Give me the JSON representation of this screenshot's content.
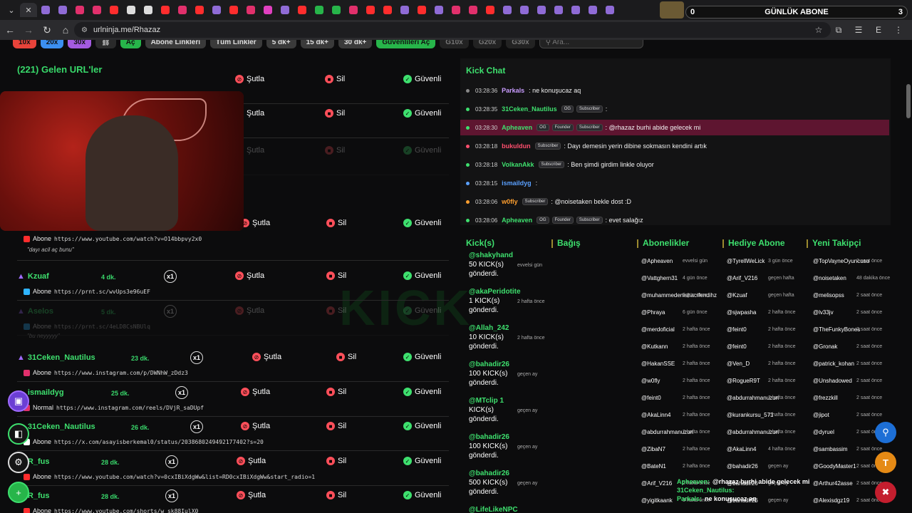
{
  "browser": {
    "url": "urlninja.me/Rhazaz",
    "overlay_title": "GÜNLÜK ABONE",
    "overlay_left": "0",
    "overlay_right": "3"
  },
  "filters": {
    "items": [
      {
        "label": "10x",
        "color": "#e8433a"
      },
      {
        "label": "20x",
        "color": "#3c8ff0"
      },
      {
        "label": "30x",
        "color": "#a45be0"
      },
      {
        "label": "Aç",
        "color": "#27b54a"
      },
      {
        "label": "Abone Linkleri",
        "color": "#3a3a3a"
      },
      {
        "label": "Tüm Linkler",
        "color": "#3a3a3a"
      },
      {
        "label": "5 dk+",
        "color": "#3a3a3a"
      },
      {
        "label": "15 dk+",
        "color": "#3a3a3a"
      },
      {
        "label": "30 dk+",
        "color": "#3a3a3a"
      },
      {
        "label": "Güvenlileri Aç",
        "color": "#27b54a"
      },
      {
        "label": "G10x",
        "color": "#222222"
      },
      {
        "label": "G20x",
        "color": "#222222"
      },
      {
        "label": "G30x",
        "color": "#222222"
      }
    ],
    "search_placeholder": "Ara..."
  },
  "url_list": {
    "title": "(221) Gelen URL'ler",
    "actions": {
      "ban": "Şutla",
      "delete": "Sil",
      "safe": "Güvenli"
    },
    "rows": [
      {
        "user": "Kzuaf",
        "time": "4 dk.",
        "count": "x1",
        "type": "Abone",
        "url": "https://prnt.sc/wvUps3e96uEF",
        "src_color": "#2fb4ff"
      },
      {
        "user": "Aselos",
        "time": "5 dk.",
        "count": "x1",
        "type": "Abone",
        "url": "https://prnt.sc/4eLD8CsNBUlq",
        "note": "bu neyyyyy",
        "src_color": "#2fb4ff",
        "dim": true
      },
      {
        "user": "31Ceken_Nautilus",
        "time": "23 dk.",
        "count": "x1",
        "type": "Abone",
        "url": "https://www.instagram.com/p/DWNhW_zDdz3",
        "src_color": "#e1306c"
      },
      {
        "user": "ismaildyg",
        "time": "25 dk.",
        "count": "x1",
        "type": "Normal",
        "url": "https://www.instagram.com/reels/DVjR_saDUpf",
        "src_color": "#e1306c"
      },
      {
        "user": "31Ceken_Nautilus",
        "time": "26 dk.",
        "count": "x1",
        "type": "Abone",
        "url": "https://x.com/asayisberkemal0/status/2038680249492177402?s=20",
        "src_color": "#ffffff"
      },
      {
        "user": "R_fus",
        "time": "28 dk.",
        "count": "x1",
        "type": "Abone",
        "url": "https://www.youtube.com/watch?v=0cxIBiXdgWw&list=RD0cxIBiXdgWw&start_radio=1",
        "src_color": "#ff2d2d"
      },
      {
        "user": "R_fus",
        "time": "28 dk.",
        "count": "x1",
        "type": "Abone",
        "url": "https://www.youtube.com/shorts/w_sk88IulX0",
        "src_color": "#ff2d2d"
      }
    ],
    "partial_row": {
      "type": "Abone",
      "url": "https://www.youtube.com/watch?v=O14bbpvy2x0",
      "note": "dayı acil aç bunu"
    }
  },
  "chat": {
    "title": "Kick Chat",
    "messages": [
      {
        "time": "03:28:36",
        "name": "Parkals",
        "name_color": "#c99cff",
        "badges": [],
        "text": ": ne konuşucaz aq",
        "dot": "#888888"
      },
      {
        "time": "03:28:35",
        "name": "31Ceken_Nautilus",
        "name_color": "#3ee06e",
        "badges": [
          "OG",
          "Subscriber"
        ],
        "text": ":",
        "dot": "#3ee06e"
      },
      {
        "time": "03:28:30",
        "name": "Apheaven",
        "name_color": "#3ee06e",
        "badges": [
          "OG",
          "Founder",
          "Subscriber"
        ],
        "text": ": @rhazaz burhi abide gelecek mi",
        "dot": "#3ee06e",
        "highlight": true
      },
      {
        "time": "03:28:18",
        "name": "bukuldun",
        "name_color": "#ff4f6e",
        "badges": [
          "Subscriber"
        ],
        "text": ": Dayı demesin yerin dibine sokmasın kendini artık",
        "dot": "#ff4f6e"
      },
      {
        "time": "03:28:18",
        "name": "VolkanAkk",
        "name_color": "#3ee06e",
        "badges": [
          "Subscriber"
        ],
        "text": ": Ben şimdi girdim linkle oluyor",
        "dot": "#3ee06e"
      },
      {
        "time": "03:28:15",
        "name": "ismaildyg",
        "name_color": "#5aa0ff",
        "badges": [],
        "text": ":",
        "dot": "#5aa0ff"
      },
      {
        "time": "03:28:06",
        "name": "w0fly",
        "name_color": "#ff9f2f",
        "badges": [
          "Subscriber"
        ],
        "text": ": @noisetaken bekle dost :D",
        "dot": "#ff9f2f"
      },
      {
        "time": "03:28:06",
        "name": "Apheaven",
        "name_color": "#3ee06e",
        "badges": [
          "OG",
          "Founder",
          "Subscriber"
        ],
        "text": ": evet salağız",
        "dot": "#3ee06e"
      }
    ]
  },
  "stats": {
    "headers": [
      "Kick(s)",
      "Bağış",
      "Abonelikler",
      "Hediye Abone",
      "Yeni Takipçi"
    ],
    "kicks": [
      {
        "name": "@shakyhand",
        "amount": "50 KICK(s)",
        "sent": "gönderdi.",
        "time": "evvelsi gün"
      },
      {
        "name": "@akaPeridotite",
        "amount": "1 KICK(s)",
        "sent": "gönderdi.",
        "time": "2 hafta önce"
      },
      {
        "name": "@Allah_242",
        "amount": "10 KICK(s)",
        "sent": "gönderdi.",
        "time": "2 hafta önce"
      },
      {
        "name": "@bahadir26",
        "amount": "100 KICK(s)",
        "sent": "gönderdi.",
        "time": "geçen ay"
      },
      {
        "name": "@MTclip 1",
        "amount": "KICK(s)",
        "sent": "gönderdi.",
        "time": "geçen ay"
      },
      {
        "name": "@bahadir26",
        "amount": "100 KICK(s)",
        "sent": "gönderdi.",
        "time": "geçen ay"
      },
      {
        "name": "@bahadir26",
        "amount": "500 KICK(s)",
        "sent": "gönderdi.",
        "time": "geçen ay"
      },
      {
        "name": "@LifeLikeNPC",
        "amount": "",
        "sent": "",
        "time": ""
      }
    ],
    "subs": [
      [
        "@Apheaven",
        "evvelsi gün"
      ],
      [
        "@Vattghern31",
        "4 gün önce"
      ],
      [
        "@muhammedenishacıfendihz",
        "5 gün önce"
      ],
      [
        "@Phraya",
        "6 gün önce"
      ],
      [
        "@merdoficial",
        "2 hafta önce"
      ],
      [
        "@Kutkann",
        "2 hafta önce"
      ],
      [
        "@HakanSSE",
        "2 hafta önce"
      ],
      [
        "@w0fly",
        "2 hafta önce"
      ],
      [
        "@feint0",
        "2 hafta önce"
      ],
      [
        "@AkaLinn4",
        "2 hafta önce"
      ],
      [
        "@abdurrahmanuzun",
        "2 hafta önce"
      ],
      [
        "@ZibaN7",
        "2 hafta önce"
      ],
      [
        "@BateN1",
        "2 hafta önce"
      ],
      [
        "@Arif_V216",
        "2 hafta önce"
      ],
      [
        "@yigitkaank",
        "3 hafta önce"
      ]
    ],
    "gifts": [
      [
        "@TyrellWeLick",
        "3 gün önce"
      ],
      [
        "@Arif_V216",
        "geçen hafta"
      ],
      [
        "@Kzuaf",
        "geçen hafta"
      ],
      [
        "@sjwpasha",
        "2 hafta önce"
      ],
      [
        "@feint0",
        "2 hafta önce"
      ],
      [
        "@feint0",
        "2 hafta önce"
      ],
      [
        "@Ven_D",
        "2 hafta önce"
      ],
      [
        "@RogueR9T",
        "2 hafta önce"
      ],
      [
        "@abdurrahmanuzun",
        "2 hafta önce"
      ],
      [
        "@kurankursu_571",
        "2 hafta önce"
      ],
      [
        "@abdurrahmanuzun",
        "2 hafta önce"
      ],
      [
        "@AkaLinn4",
        "4 hafta önce"
      ],
      [
        "@bahadir26",
        "geçen ay"
      ],
      [
        "@bahadir26",
        "geçen ay"
      ],
      [
        "@bahadir26",
        "geçen ay"
      ]
    ],
    "follows": [
      [
        "@TopVayneOyuncusu",
        "2 saat önce"
      ],
      [
        "@noisetaken",
        "48 dakika önce"
      ],
      [
        "@melisopss",
        "2 saat önce"
      ],
      [
        "@lv33jv",
        "2 saat önce"
      ],
      [
        "@TheFunkyBones",
        "2 saat önce"
      ],
      [
        "@Gronak",
        "2 saat önce"
      ],
      [
        "@patrick_kohan",
        "2 saat önce"
      ],
      [
        "@Unshadowed",
        "2 saat önce"
      ],
      [
        "@frezzkill",
        "2 saat önce"
      ],
      [
        "@jipot",
        "2 saat önce"
      ],
      [
        "@dyruel",
        "2 saat önce"
      ],
      [
        "@sambassim",
        "2 saat önce"
      ],
      [
        "@GoodyMaster1",
        "2 saat önce"
      ],
      [
        "@Arthur42asse",
        "2 saat önce"
      ],
      [
        "@Alexisdgz19",
        "2 saat önce"
      ]
    ]
  },
  "popup_chat": [
    {
      "name": "Apheaven:",
      "text": "@rhazaz burhi abide gelecek mi"
    },
    {
      "name": "31Ceken_Nautilus:",
      "text": ""
    },
    {
      "name": "Parkals:",
      "text": "ne konuşucaz aq"
    }
  ]
}
